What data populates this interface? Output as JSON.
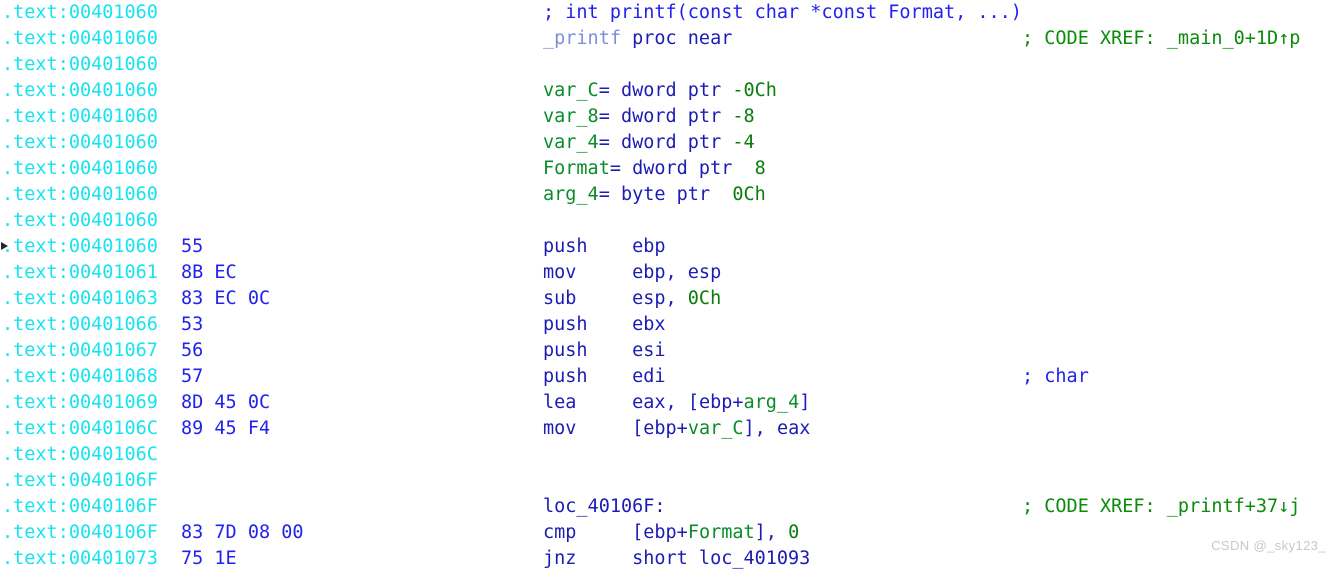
{
  "view": {
    "name": "ida-disassembly-view",
    "segment": ".text",
    "colors": {
      "background": "#ffffff",
      "address": "#18e3ef",
      "bytes": "#2222ee",
      "mnemonic": "#1c1cb4",
      "variable": "#0a8c2a",
      "number": "#0a7d0a",
      "auto_comment": "#2222ee",
      "xref_comment": "#0a8c0a",
      "function_name": "#7f8fd8",
      "watermark": "#c9c9c9"
    }
  },
  "watermark": "CSDN @_sky123_",
  "lines": [
    {
      "address": ".text:00401060",
      "bytes": "",
      "code": "; int printf(const char *const Format, ...)",
      "code_class": "c-cmt",
      "comment": "",
      "comment_class": "c-xref",
      "marker": false
    },
    {
      "address": ".text:00401060",
      "bytes": "",
      "code": "_printf proc near",
      "code_class": "split-proc",
      "comment": "; CODE XREF: _main_0+1D↑p",
      "comment_class": "c-xref",
      "marker": false
    },
    {
      "address": ".text:00401060",
      "bytes": "",
      "code": "",
      "code_class": "c-mnem",
      "comment": "",
      "comment_class": "c-xref",
      "marker": false
    },
    {
      "address": ".text:00401060",
      "bytes": "",
      "code": "var_C= dword ptr -0Ch",
      "code_class": "split-var",
      "comment": "",
      "comment_class": "c-xref",
      "marker": false
    },
    {
      "address": ".text:00401060",
      "bytes": "",
      "code": "var_8= dword ptr -8",
      "code_class": "split-var",
      "comment": "",
      "comment_class": "c-xref",
      "marker": false
    },
    {
      "address": ".text:00401060",
      "bytes": "",
      "code": "var_4= dword ptr -4",
      "code_class": "split-var",
      "comment": "",
      "comment_class": "c-xref",
      "marker": false
    },
    {
      "address": ".text:00401060",
      "bytes": "",
      "code": "Format= dword ptr  8",
      "code_class": "split-var",
      "comment": "",
      "comment_class": "c-xref",
      "marker": false
    },
    {
      "address": ".text:00401060",
      "bytes": "",
      "code": "arg_4= byte ptr  0Ch",
      "code_class": "split-var",
      "comment": "",
      "comment_class": "c-xref",
      "marker": false
    },
    {
      "address": ".text:00401060",
      "bytes": "",
      "code": "",
      "code_class": "c-mnem",
      "comment": "",
      "comment_class": "c-xref",
      "marker": false
    },
    {
      "address": ".text:00401060",
      "bytes": "55",
      "code": "push    ebp",
      "code_class": "c-mnem",
      "comment": "",
      "comment_class": "c-xref",
      "marker": true
    },
    {
      "address": ".text:00401061",
      "bytes": "8B EC",
      "code": "mov     ebp, esp",
      "code_class": "c-mnem",
      "comment": "",
      "comment_class": "c-xref",
      "marker": false
    },
    {
      "address": ".text:00401063",
      "bytes": "83 EC 0C",
      "code": "sub     esp, 0Ch",
      "code_class": "split-num",
      "comment": "",
      "comment_class": "c-xref",
      "marker": false
    },
    {
      "address": ".text:00401066",
      "bytes": "53",
      "code": "push    ebx",
      "code_class": "c-mnem",
      "comment": "",
      "comment_class": "c-xref",
      "marker": false
    },
    {
      "address": ".text:00401067",
      "bytes": "56",
      "code": "push    esi",
      "code_class": "c-mnem",
      "comment": "",
      "comment_class": "c-xref",
      "marker": false
    },
    {
      "address": ".text:00401068",
      "bytes": "57",
      "code": "push    edi",
      "code_class": "c-mnem",
      "comment": "; char",
      "comment_class": "c-cmt",
      "marker": false
    },
    {
      "address": ".text:00401069",
      "bytes": "8D 45 0C",
      "code": "lea     eax, [ebp+arg_4]",
      "code_class": "split-mem",
      "comment": "",
      "comment_class": "c-xref",
      "marker": false
    },
    {
      "address": ".text:0040106C",
      "bytes": "89 45 F4",
      "code": "mov     [ebp+var_C], eax",
      "code_class": "split-mem",
      "comment": "",
      "comment_class": "c-xref",
      "marker": false
    },
    {
      "address": ".text:0040106C",
      "bytes": "",
      "code": "",
      "code_class": "c-mnem",
      "comment": "",
      "comment_class": "c-xref",
      "marker": false
    },
    {
      "address": ".text:0040106F",
      "bytes": "",
      "code": "",
      "code_class": "c-mnem",
      "comment": "",
      "comment_class": "c-xref",
      "marker": false
    },
    {
      "address": ".text:0040106F",
      "bytes": "",
      "code": "loc_40106F:",
      "code_class": "c-loc",
      "comment": "; CODE XREF: _printf+37↓j",
      "comment_class": "c-xref",
      "marker": false
    },
    {
      "address": ".text:0040106F",
      "bytes": "83 7D 08 00",
      "code": "cmp     [ebp+Format], 0",
      "code_class": "split-mem",
      "comment": "",
      "comment_class": "c-xref",
      "marker": false
    },
    {
      "address": ".text:00401073",
      "bytes": "75 1E",
      "code": "jnz     short loc_401093",
      "code_class": "c-mnem",
      "comment": "",
      "comment_class": "c-xref",
      "marker": false
    }
  ]
}
